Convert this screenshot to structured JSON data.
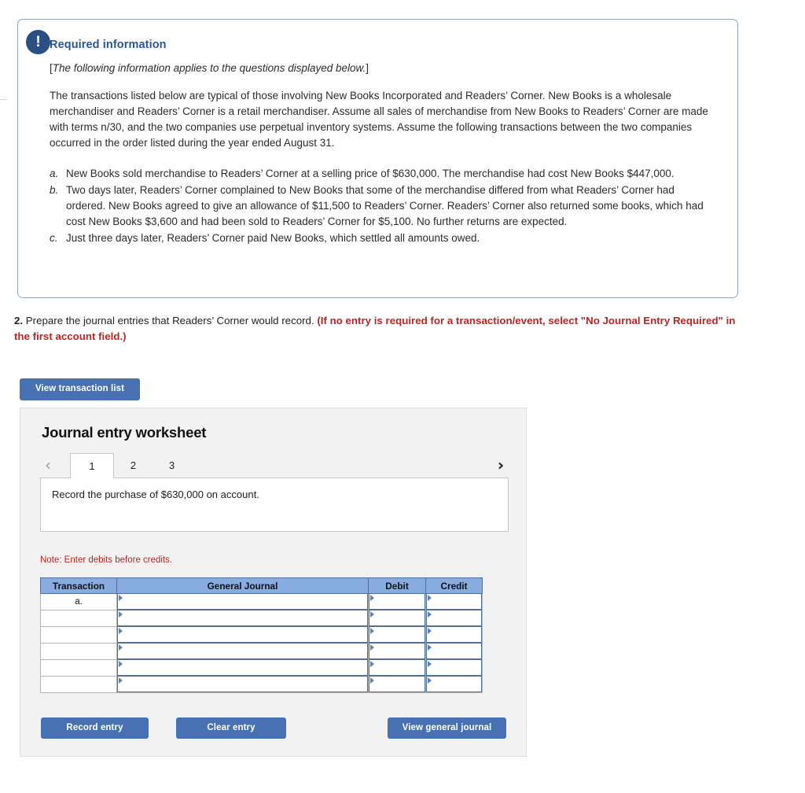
{
  "info_card": {
    "badge_icon": "exclamation-icon",
    "badge_label": "!",
    "title": "Required information",
    "bracket_open": "[",
    "italic_note": "The following information applies to the questions displayed below.",
    "bracket_close": "]",
    "paragraph": "The transactions listed below are typical of those involving New Books Incorporated and Readers’ Corner. New Books is a wholesale merchandiser and Readers’ Corner is a retail merchandiser. Assume all sales of merchandise from New Books to Readers’ Corner are made with terms n/30, and the two companies use perpetual inventory systems. Assume the following transactions between the two companies occurred in the order listed during the year ended August 31.",
    "items": [
      {
        "marker": "a.",
        "text": "New Books sold merchandise to Readers’ Corner at a selling price of $630,000. The merchandise had cost New Books $447,000."
      },
      {
        "marker": "b.",
        "text": "Two days later, Readers’ Corner complained to New Books that some of the merchandise differed from what Readers’ Corner had ordered. New Books agreed to give an allowance of $11,500 to Readers’ Corner. Readers’ Corner also returned some books, which had cost New Books $3,600 and had been sold to Readers’ Corner for $5,100. No further returns are expected."
      },
      {
        "marker": "c.",
        "text": "Just three days later, Readers’ Corner paid New Books, which settled all amounts owed."
      }
    ]
  },
  "question": {
    "number": "2.",
    "text": "Prepare the journal entries that Readers’ Corner would record.",
    "highlight": "(If no entry is required for a transaction/event, select \"No Journal Entry Required\" in the first account field.)"
  },
  "toolbar": {
    "view_transaction_list": "View transaction list"
  },
  "worksheet": {
    "title": "Journal entry worksheet",
    "tabs": [
      {
        "label": "1",
        "active": true
      },
      {
        "label": "2",
        "active": false
      },
      {
        "label": "3",
        "active": false
      }
    ],
    "prev_arrow": "‹",
    "next_arrow": "›",
    "prompt": "Record the purchase of $630,000 on account.",
    "note": "Note: Enter debits before credits.",
    "table": {
      "columns": [
        "Transaction",
        "General Journal",
        "Debit",
        "Credit"
      ],
      "rows": [
        {
          "transaction": "a.",
          "general_journal": "",
          "debit": "",
          "credit": ""
        },
        {
          "transaction": "",
          "general_journal": "",
          "debit": "",
          "credit": ""
        },
        {
          "transaction": "",
          "general_journal": "",
          "debit": "",
          "credit": ""
        },
        {
          "transaction": "",
          "general_journal": "",
          "debit": "",
          "credit": ""
        },
        {
          "transaction": "",
          "general_journal": "",
          "debit": "",
          "credit": ""
        },
        {
          "transaction": "",
          "general_journal": "",
          "debit": "",
          "credit": ""
        }
      ]
    },
    "buttons": {
      "record_entry": "Record entry",
      "clear_entry": "Clear entry",
      "view_general_journal": "View general journal"
    }
  },
  "colors": {
    "button_blue": "#4771b2",
    "badge_navy": "#2c4f83",
    "heading_blue": "#2a5596",
    "alert_red": "#c0231f",
    "table_header_blue": "#89ace0",
    "card_border": "#8fa6c6"
  }
}
